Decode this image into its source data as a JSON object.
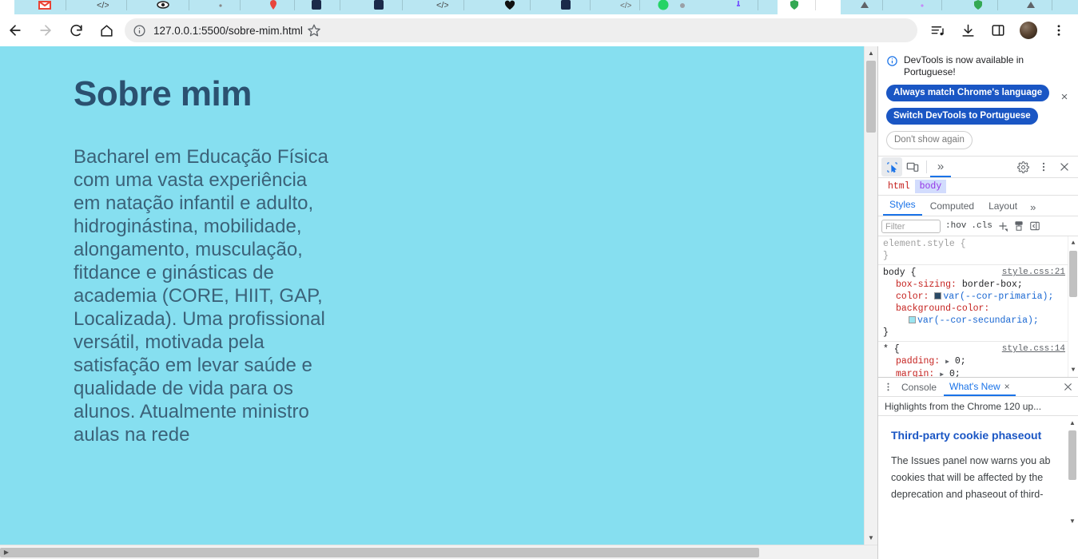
{
  "browser": {
    "tabs": [
      {
        "favicon": "gmail-icon",
        "color": "#ea4335"
      },
      {
        "favicon": "code-icon",
        "color": "#555555"
      },
      {
        "favicon": "code-icon",
        "color": "#333333"
      },
      {
        "favicon": "dot-icon",
        "color": "#888888"
      },
      {
        "favicon": "eye-icon",
        "color": "#222222"
      },
      {
        "favicon": "location-icon",
        "color": "#e8453c"
      },
      {
        "favicon": "file-icon",
        "color": "#1b2a4a"
      },
      {
        "favicon": "file-icon",
        "color": "#1b2a4a"
      },
      {
        "favicon": "code-icon",
        "color": "#444444"
      },
      {
        "favicon": "heart-icon",
        "color": "#111111"
      },
      {
        "favicon": "file-icon",
        "color": "#1b2a4a"
      },
      {
        "favicon": "doc-icon",
        "color": "#666666"
      },
      {
        "favicon": "whatsapp-icon",
        "color": "#25d366"
      },
      {
        "favicon": "cloud-icon",
        "color": "#9aa0a6"
      },
      {
        "favicon": "pin-icon",
        "color": "#7b61ff"
      },
      {
        "favicon": "shield-icon",
        "color": "#34a853"
      },
      {
        "favicon": "triangle-icon",
        "color": "#5f6368"
      }
    ],
    "toolbar": {
      "back": "back-arrow",
      "forward": "forward-arrow",
      "reload": "reload-icon",
      "home": "home-icon",
      "url": "127.0.0.1:5500/sobre-mim.html",
      "site_info": "info-icon",
      "bookmark": "star-icon",
      "media": "media-list-icon",
      "downloads": "download-icon",
      "side_panel": "side-panel-icon",
      "profile": "avatar",
      "menu": "three-dot-menu"
    }
  },
  "page": {
    "title": "Sobre mim",
    "body": "Bacharel em Educação Física com uma vasta experiência em natação infantil e adulto, hidroginástina, mobilidade, alongamento, musculação, fitdance e ginásticas de academia (CORE, HIIT, GAP, Localizada). Uma profissional versátil, motivada pela satisfação em levar saúde e qualidade de vida para os alunos. Atualmente ministro aulas na rede",
    "background_color": "#86dff0",
    "title_color": "#2b5170",
    "text_color": "#3b6279"
  },
  "devtools": {
    "language_banner": {
      "message": "DevTools is now available in Portuguese!",
      "primary_button": "Always match Chrome's language",
      "secondary_button": "Switch DevTools to Portuguese",
      "dismiss_button": "Don't show again",
      "close": "×"
    },
    "toolbar": {
      "inspect": "inspect-element-icon",
      "device": "device-toolbar-icon",
      "more_panels": "»",
      "settings": "gear-icon",
      "more_options": "three-dot-menu",
      "close": "×"
    },
    "breadcrumb": [
      "html",
      "body"
    ],
    "panes": {
      "tabs": [
        "Styles",
        "Computed",
        "Layout"
      ],
      "active": "Styles",
      "overflow": "»"
    },
    "filter_bar": {
      "placeholder": "Filter",
      "hov": ":hov",
      "cls": ".cls",
      "new_rule": "plus-icon",
      "print_styles": "print-icon",
      "toggle_sidebar": "sidebar-toggle-icon"
    },
    "css_rules": [
      {
        "selector": "element.style {",
        "source": "",
        "close": "}",
        "greyed": true,
        "declarations": []
      },
      {
        "selector": "body {",
        "source": "style.css:21",
        "close": "}",
        "greyed": false,
        "declarations": [
          {
            "prop": "box-sizing:",
            "value": "border-box;",
            "swatch": ""
          },
          {
            "prop": "color:",
            "value": "var(--cor-primaria);",
            "swatch": "#2b4a66"
          },
          {
            "prop": "background-color:",
            "value": "var(--cor-secundaria);",
            "swatch": "#9ae4f0",
            "wrap": true
          }
        ]
      },
      {
        "selector": "* {",
        "source": "style.css:14",
        "close": "}",
        "greyed": false,
        "declarations": [
          {
            "prop": "padding:",
            "value": "0;",
            "tri": true
          },
          {
            "prop": "margin:",
            "value": "0;",
            "tri": true
          }
        ]
      }
    ],
    "drawer": {
      "more": "three-dot-menu",
      "tabs": [
        "Console",
        "What's New"
      ],
      "active": "What's New",
      "tab_close": "×",
      "drawer_close": "×",
      "whats_new_header": "Highlights from the Chrome 120 up...",
      "article_title": "Third-party cookie phaseout",
      "article_text": "The Issues panel now warns you ab\ncookies that will be affected by the\ndeprecation and phaseout of third-"
    }
  }
}
